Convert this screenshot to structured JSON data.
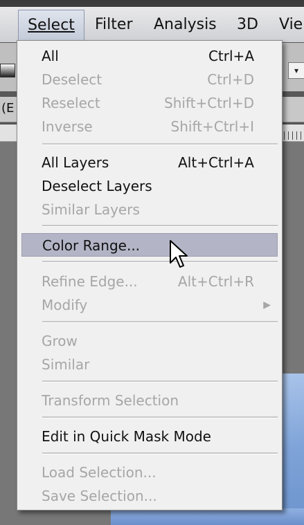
{
  "menubar": {
    "items": [
      {
        "label": "Select",
        "active": true
      },
      {
        "label": "Filter"
      },
      {
        "label": "Analysis"
      },
      {
        "label": "3D"
      },
      {
        "label": "Vie"
      }
    ]
  },
  "doc_tab_fragment": "(E",
  "options_dropdown_glyph": "▾",
  "menu": {
    "items": [
      {
        "label": "All",
        "shortcut": "Ctrl+A",
        "enabled": true
      },
      {
        "label": "Deselect",
        "shortcut": "Ctrl+D",
        "enabled": false
      },
      {
        "label": "Reselect",
        "shortcut": "Shift+Ctrl+D",
        "enabled": false
      },
      {
        "label": "Inverse",
        "shortcut": "Shift+Ctrl+I",
        "enabled": false
      },
      {
        "label": "All Layers",
        "shortcut": "Alt+Ctrl+A",
        "enabled": true
      },
      {
        "label": "Deselect Layers",
        "shortcut": "",
        "enabled": true
      },
      {
        "label": "Similar Layers",
        "shortcut": "",
        "enabled": false
      },
      {
        "label": "Color Range...",
        "shortcut": "",
        "enabled": true,
        "highlighted": true
      },
      {
        "label": "Refine Edge...",
        "shortcut": "Alt+Ctrl+R",
        "enabled": false
      },
      {
        "label": "Modify",
        "shortcut": "",
        "enabled": false,
        "submenu": true
      },
      {
        "label": "Grow",
        "shortcut": "",
        "enabled": false
      },
      {
        "label": "Similar",
        "shortcut": "",
        "enabled": false
      },
      {
        "label": "Transform Selection",
        "shortcut": "",
        "enabled": false
      },
      {
        "label": "Edit in Quick Mask Mode",
        "shortcut": "",
        "enabled": true
      },
      {
        "label": "Load Selection...",
        "shortcut": "",
        "enabled": false
      },
      {
        "label": "Save Selection...",
        "shortcut": "",
        "enabled": false
      }
    ]
  },
  "colors": {
    "menu_bg": "#f0f0f0",
    "enabled_text": "#111111",
    "disabled_text": "#a6a6a6",
    "highlight_bg": "#b3b5c6"
  }
}
